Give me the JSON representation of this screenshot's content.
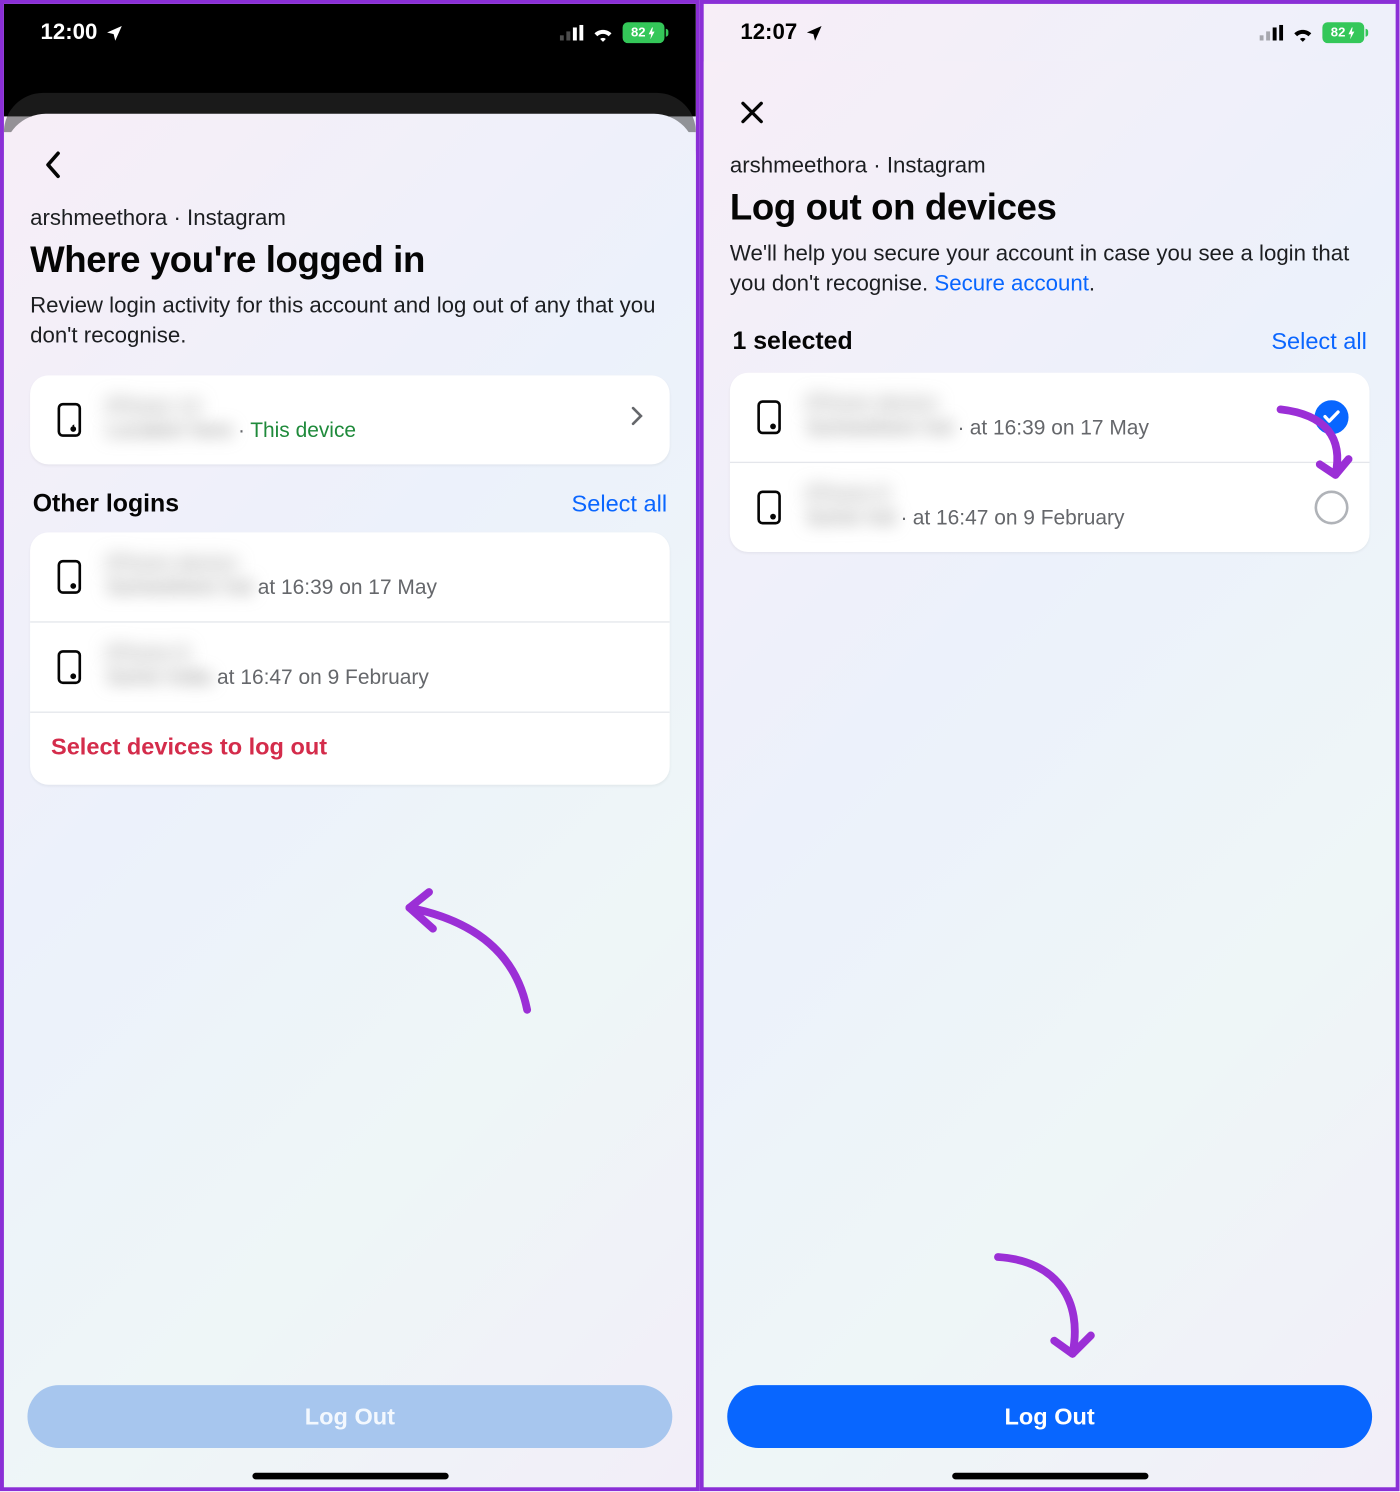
{
  "left": {
    "status": {
      "time": "12:00",
      "battery": "82"
    },
    "breadcrumb": "arshmeethora · Instagram",
    "title": "Where you're logged in",
    "desc": "Review login activity for this account and log out of any that you don't recognise.",
    "current": {
      "name_masked": "iPhone 14",
      "loc_masked": "Location here",
      "this_device": "This device"
    },
    "other_header": "Other logins",
    "select_all": "Select all",
    "logins": [
      {
        "name_masked": "iPhone device",
        "loc_masked": "Somewhere Ind",
        "time": "at 16:39 on 17 May"
      },
      {
        "name_masked": "iPhone 8",
        "loc_masked": "Some India",
        "time": "at 16:47 on 9 February"
      }
    ],
    "select_devices": "Select devices to log out",
    "logout": "Log Out"
  },
  "right": {
    "status": {
      "time": "12:07",
      "battery": "82"
    },
    "breadcrumb": "arshmeethora · Instagram",
    "title": "Log out on devices",
    "desc_pre": "We'll help you secure your account in case you see a login that you don't recognise. ",
    "secure_link": "Secure account",
    "desc_post": ".",
    "selected_count": "1 selected",
    "select_all": "Select all",
    "devices": [
      {
        "name_masked": "iPhone device",
        "loc_masked": "Somewhere Ind",
        "time": "at 16:39 on 17 May",
        "checked": true
      },
      {
        "name_masked": "iPhone 8",
        "loc_masked": "Some Ind",
        "time": "at 16:47 on 9 February",
        "checked": false
      }
    ],
    "logout": "Log Out"
  }
}
